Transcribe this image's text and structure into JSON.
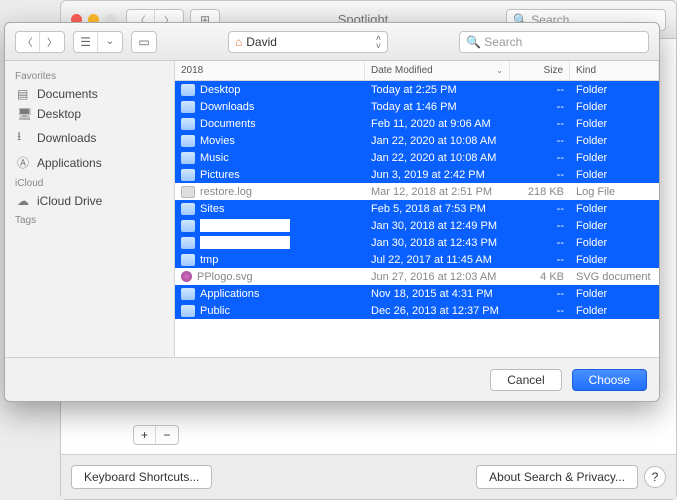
{
  "bg": {
    "title": "Spotlight",
    "search_placeholder": "Search",
    "kbs": "Keyboard Shortcuts...",
    "about": "About Search & Privacy...",
    "help": "?"
  },
  "sheet": {
    "path_label": "David",
    "search_placeholder": "Search",
    "cancel": "Cancel",
    "choose": "Choose"
  },
  "sidebar": {
    "favorites_head": "Favorites",
    "items": [
      {
        "icon": "document-icon",
        "label": "Documents"
      },
      {
        "icon": "desktop-icon",
        "label": "Desktop"
      },
      {
        "icon": "downloads-icon",
        "label": "Downloads"
      },
      {
        "icon": "applications-icon",
        "label": "Applications"
      }
    ],
    "icloud_head": "iCloud",
    "icloud_label": "iCloud Drive",
    "tags_head": "Tags"
  },
  "columns": {
    "name": "2018",
    "date": "Date Modified",
    "size": "Size",
    "kind": "Kind"
  },
  "rows": [
    {
      "sel": true,
      "icon": "folder",
      "name": "Desktop",
      "date": "Today at 2:25 PM",
      "size": "--",
      "kind": "Folder"
    },
    {
      "sel": true,
      "icon": "folder",
      "name": "Downloads",
      "date": "Today at 1:46 PM",
      "size": "--",
      "kind": "Folder"
    },
    {
      "sel": true,
      "icon": "folder",
      "name": "Documents",
      "date": "Feb 11, 2020 at 9:06 AM",
      "size": "--",
      "kind": "Folder"
    },
    {
      "sel": true,
      "icon": "folder",
      "name": "Movies",
      "date": "Jan 22, 2020 at 10:08 AM",
      "size": "--",
      "kind": "Folder"
    },
    {
      "sel": true,
      "icon": "folder",
      "name": "Music",
      "date": "Jan 22, 2020 at 10:08 AM",
      "size": "--",
      "kind": "Folder"
    },
    {
      "sel": true,
      "icon": "folder",
      "name": "Pictures",
      "date": "Jun 3, 2019 at 2:42 PM",
      "size": "--",
      "kind": "Folder"
    },
    {
      "sel": false,
      "icon": "doc",
      "name": "restore.log",
      "date": "Mar 12, 2018 at 2:51 PM",
      "size": "218 KB",
      "kind": "Log File"
    },
    {
      "sel": true,
      "icon": "folder",
      "name": "Sites",
      "date": "Feb 5, 2018 at 7:53 PM",
      "size": "--",
      "kind": "Folder"
    },
    {
      "sel": true,
      "icon": "folder",
      "name": "",
      "date": "Jan 30, 2018 at 12:49 PM",
      "size": "--",
      "kind": "Folder",
      "redacted": true
    },
    {
      "sel": true,
      "icon": "folder",
      "name": "",
      "date": "Jan 30, 2018 at 12:43 PM",
      "size": "--",
      "kind": "Folder",
      "redacted": true
    },
    {
      "sel": true,
      "icon": "folder",
      "name": "tmp",
      "date": "Jul 22, 2017 at 11:45 AM",
      "size": "--",
      "kind": "Folder"
    },
    {
      "sel": false,
      "icon": "svg",
      "name": "PPlogo.svg",
      "date": "Jun 27, 2016 at 12:03 AM",
      "size": "4 KB",
      "kind": "SVG document"
    },
    {
      "sel": true,
      "icon": "folder",
      "name": "Applications",
      "date": "Nov 18, 2015 at 4:31 PM",
      "size": "--",
      "kind": "Folder"
    },
    {
      "sel": true,
      "icon": "folder",
      "name": "Public",
      "date": "Dec 26, 2013 at 12:37 PM",
      "size": "--",
      "kind": "Folder"
    }
  ]
}
